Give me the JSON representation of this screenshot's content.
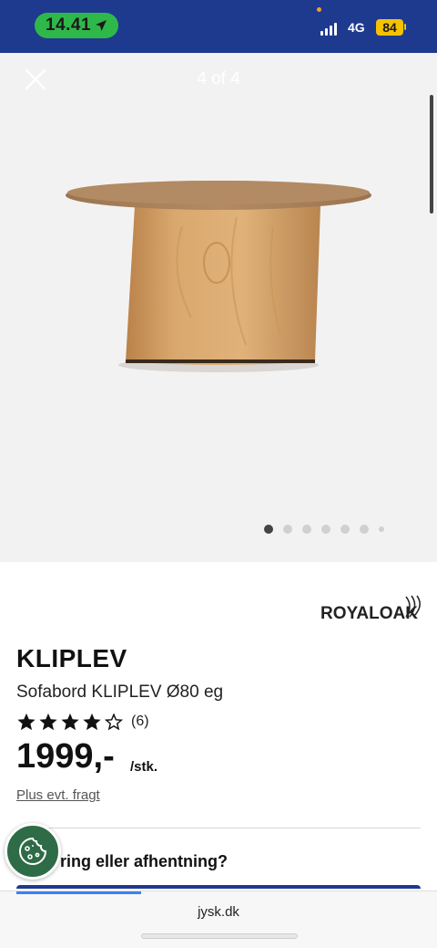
{
  "status_bar": {
    "time": "14.41",
    "network": "4G",
    "battery": "84",
    "icons": [
      "location-arrow-icon",
      "signal-bars-icon",
      "battery-icon"
    ]
  },
  "gallery": {
    "counter": "4 of 4",
    "image_count": 7,
    "active_index": 0,
    "icons": [
      "close-icon"
    ]
  },
  "product": {
    "brand": "ROYALOAK",
    "name": "KLIPLEV",
    "description": "Sofabord KLIPLEV Ø80 eg",
    "rating": 4,
    "rating_max": 5,
    "review_count": "(6)",
    "price": "1999,-",
    "unit": "/stk.",
    "shipping_note": "Plus evt. fragt"
  },
  "delivery": {
    "question": "ring eller afhentning?"
  },
  "browser": {
    "url": "jysk.dk"
  },
  "colors": {
    "brand_blue": "#1e3a8f",
    "cookie_green": "#2e6b47",
    "time_pill_green": "#2fb84a",
    "battery_yellow": "#f5c200",
    "gallery_bg": "#f3f2f2"
  }
}
